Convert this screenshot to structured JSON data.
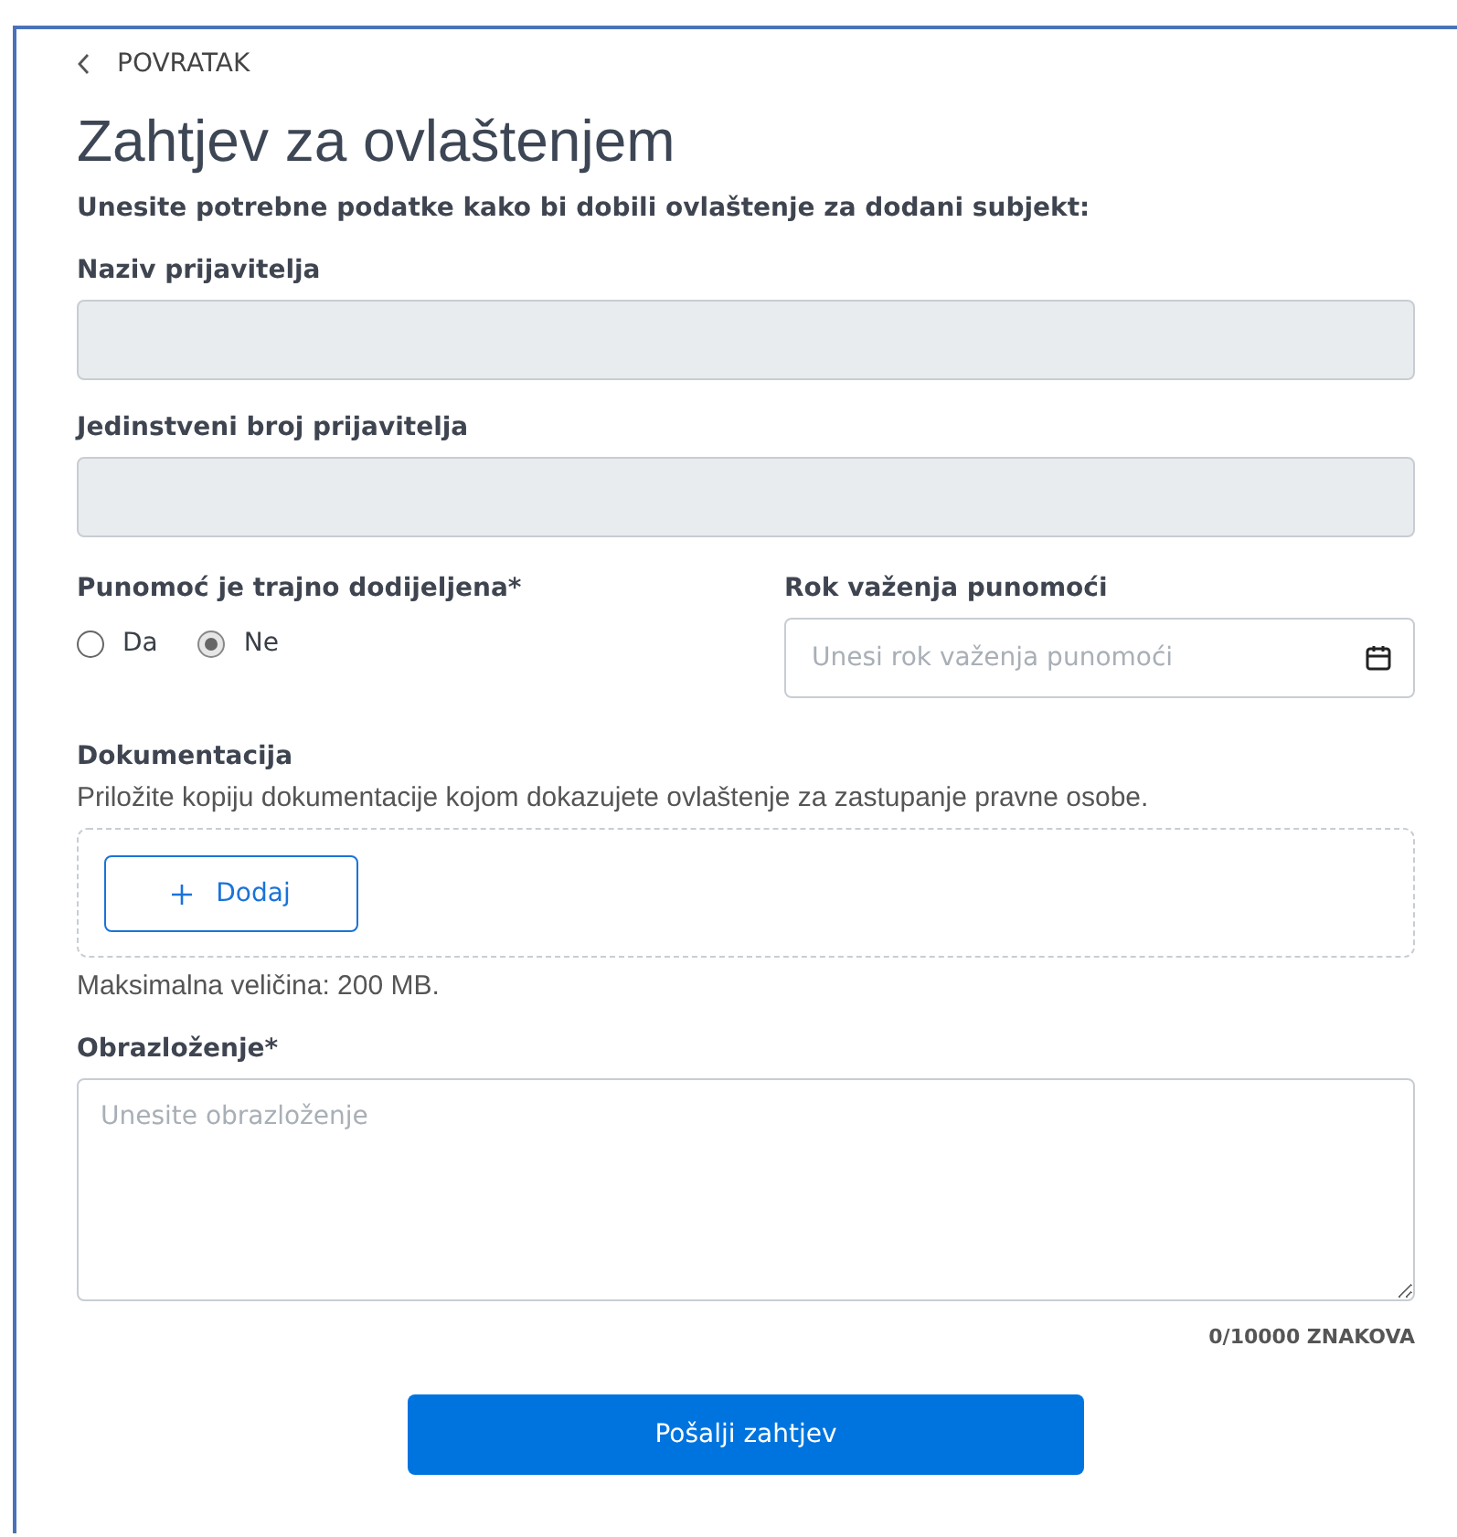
{
  "back_link": "POVRATAK",
  "title": "Zahtjev za ovlaštenjem",
  "subtitle": "Unesite potrebne podatke kako bi dobili ovlaštenje za dodani subjekt:",
  "fields": [
    {
      "label": "Naziv prijavitelja",
      "disabled": true
    },
    {
      "label": "Jedinstveni broj prijavitelja",
      "disabled": true
    }
  ],
  "permanent": {
    "label": "Punomoć je trajno dodijeljena*",
    "options": [
      {
        "label": "Da",
        "selected": false
      },
      {
        "label": "Ne",
        "selected": true
      }
    ]
  },
  "validity": {
    "label": "Rok važenja punomoći",
    "placeholder": "Unesi rok važenja punomoći"
  },
  "documents": {
    "label": "Dokumentacija",
    "description": "Priložite kopiju dokumentacije kojom dokazujete ovlaštenje za zastupanje pravne osobe.",
    "add_button": "Dodaj",
    "max_size": "Maksimalna veličina: 200 MB."
  },
  "reason": {
    "label": "Obrazloženje*",
    "placeholder": "Unesite obrazloženje",
    "counter": "0/10000 ZNAKOVA"
  },
  "submit": "Pošalji zahtjev"
}
